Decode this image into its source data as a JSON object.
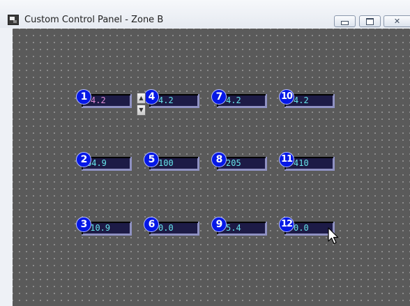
{
  "window": {
    "title": "Custom Control Panel - Zone B"
  },
  "controls": [
    {
      "number": "1",
      "value": "4.2"
    },
    {
      "number": "2",
      "value": "64.9"
    },
    {
      "number": "3",
      "value": "-10.9"
    },
    {
      "number": "4",
      "value": "4.2"
    },
    {
      "number": "5",
      "value": "100"
    },
    {
      "number": "6",
      "value": "0.0"
    },
    {
      "number": "7",
      "value": "4.2"
    },
    {
      "number": "8",
      "value": "205"
    },
    {
      "number": "9",
      "value": "5.4"
    },
    {
      "number": "10",
      "value": "4.2"
    },
    {
      "number": "11",
      "value": "410"
    },
    {
      "number": "12",
      "value": "0.0"
    }
  ],
  "colors": {
    "canvas": "#5a5a5a",
    "badge": "#0618e6",
    "display_bg": "#1d1b46",
    "value_text": "#66e4ea",
    "selected_value_text": "#e28ed8"
  },
  "icons": {
    "app": "control-panel-icon",
    "minimize": "minimize-icon",
    "maximize": "maximize-icon",
    "close": "close-icon",
    "spinner_up": "arrow-up-icon",
    "spinner_down": "arrow-down-icon",
    "cursor": "mouse-pointer-icon"
  }
}
